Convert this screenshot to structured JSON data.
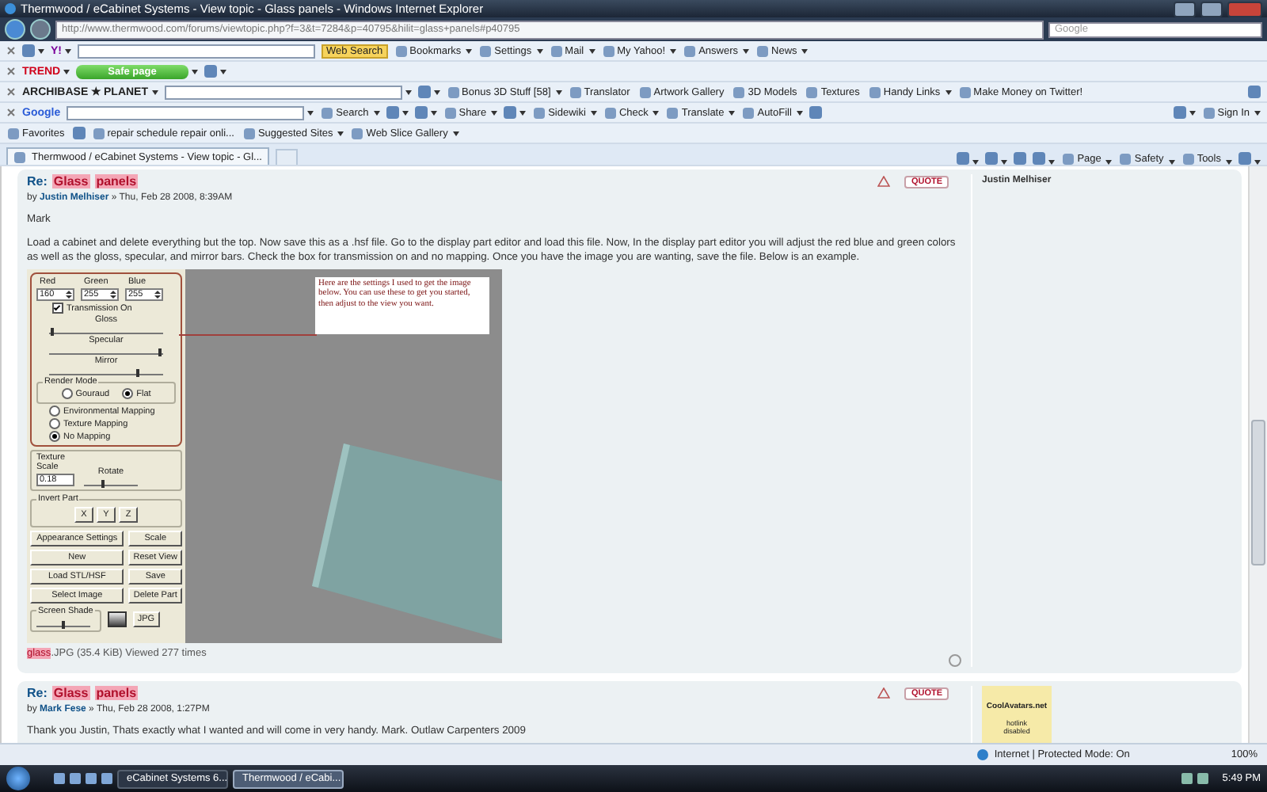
{
  "window": {
    "title": "Thermwood / eCabinet Systems - View topic - Glass panels - Windows Internet Explorer"
  },
  "address_bar": {
    "url": "http://www.thermwood.com/forums/viewtopic.php?f=3&t=7284&p=40795&hilit=glass+panels#p40795",
    "search_placeholder": "Google"
  },
  "toolbars": [
    {
      "left": [
        {
          "kind": "close"
        },
        {
          "kind": "icon",
          "dropdown": true
        },
        {
          "kind": "logo",
          "label": "Y!",
          "color": "#7b0099",
          "dropdown": true
        },
        {
          "kind": "field"
        },
        {
          "kind": "highlight",
          "label": "Web Search"
        },
        {
          "kind": "button",
          "label": "Bookmarks",
          "dropdown": true
        },
        {
          "kind": "button",
          "label": "Settings",
          "dropdown": true
        },
        {
          "kind": "button",
          "label": "Mail",
          "dropdown": true
        },
        {
          "kind": "button",
          "label": "My Yahoo!",
          "dropdown": true
        },
        {
          "kind": "button",
          "label": "Answers",
          "dropdown": true
        },
        {
          "kind": "button",
          "label": "News",
          "dropdown": true
        }
      ]
    },
    {
      "left": [
        {
          "kind": "close"
        },
        {
          "kind": "logo",
          "label": "TREND",
          "color": "#d0021b",
          "dropdown": true
        },
        {
          "kind": "pill",
          "label": "Safe page",
          "dropdown": true
        },
        {
          "kind": "icon",
          "dropdown": true
        }
      ]
    },
    {
      "left": [
        {
          "kind": "close"
        },
        {
          "kind": "logo",
          "label": "ARCHIBASE ★ PLANET",
          "color": "#222222",
          "dropdown": true
        },
        {
          "kind": "field",
          "dropdown": true
        },
        {
          "kind": "icon",
          "dropdown": true
        },
        {
          "kind": "button",
          "label": "Bonus 3D Stuff  [58]",
          "dropdown": true
        },
        {
          "kind": "button",
          "label": "Translator"
        },
        {
          "kind": "button",
          "label": "Artwork Gallery"
        },
        {
          "kind": "button",
          "label": "3D Models"
        },
        {
          "kind": "button",
          "label": "Textures"
        },
        {
          "kind": "button",
          "label": "Handy Links",
          "dropdown": true
        },
        {
          "kind": "button",
          "label": "Make Money on Twitter!"
        }
      ],
      "right": [
        {
          "kind": "icon"
        }
      ]
    },
    {
      "left": [
        {
          "kind": "close"
        },
        {
          "kind": "logo",
          "label": "Google",
          "color": "#2a5bd7"
        },
        {
          "kind": "field",
          "dropdown": true
        },
        {
          "kind": "button",
          "label": "Search",
          "dropdown": true
        },
        {
          "kind": "icon",
          "dropdown": true
        },
        {
          "kind": "icon",
          "dropdown": true
        },
        {
          "kind": "button",
          "label": "Share",
          "dropdown": true
        },
        {
          "kind": "icon",
          "dropdown": true
        },
        {
          "kind": "button",
          "label": "Sidewiki",
          "dropdown": true
        },
        {
          "kind": "button",
          "label": "Check",
          "dropdown": true
        },
        {
          "kind": "button",
          "label": "Translate",
          "dropdown": true
        },
        {
          "kind": "button",
          "label": "AutoFill",
          "dropdown": true
        },
        {
          "kind": "icon"
        }
      ],
      "right": [
        {
          "kind": "icon",
          "dropdown": true
        },
        {
          "kind": "button",
          "label": "Sign In",
          "dropdown": true
        }
      ]
    },
    {
      "left": [
        {
          "kind": "button",
          "label": "Favorites"
        },
        {
          "kind": "icon"
        },
        {
          "kind": "button",
          "label": "repair schedule repair onli..."
        },
        {
          "kind": "button",
          "label": "Suggested Sites",
          "dropdown": true
        },
        {
          "kind": "button",
          "label": "Web Slice Gallery",
          "dropdown": true
        }
      ]
    },
    {
      "left": [
        {
          "kind": "tab",
          "label": "Thermwood / eCabinet Systems - View topic - Gl..."
        },
        {
          "kind": "newtab"
        }
      ],
      "right": [
        {
          "kind": "icon",
          "dropdown": true
        },
        {
          "kind": "icon",
          "dropdown": true
        },
        {
          "kind": "icon"
        },
        {
          "kind": "icon",
          "dropdown": true
        },
        {
          "kind": "button",
          "label": "Page",
          "dropdown": true
        },
        {
          "kind": "button",
          "label": "Safety",
          "dropdown": true
        },
        {
          "kind": "button",
          "label": "Tools",
          "dropdown": true
        },
        {
          "kind": "icon",
          "dropdown": true
        }
      ]
    }
  ],
  "posts": [
    {
      "title_prefix": "Re:",
      "title_words": [
        "Glass",
        "panels"
      ],
      "byline": "by **Justin Melhiser** » Thu, Feb 28 2008, 8:39AM",
      "quote_label": "QUOTE",
      "author": "Justin Melhiser",
      "body": [
        "Mark",
        "Load a cabinet and delete everything but the top. Now save this as a .hsf file. Go to the display part editor and load this file. Now, In the display part editor you will adjust the red blue and green colors as well as the gloss, specular, and mirror bars. Check the box for transmission on and no mapping. Once you have the image you are wanting, save the file. Below is an example."
      ],
      "attachment": {
        "editor": {
          "channels": [
            {
              "label": "Red",
              "value": "160"
            },
            {
              "label": "Green",
              "value": "255"
            },
            {
              "label": "Blue",
              "value": "255"
            }
          ],
          "transmission": {
            "label": "Transmission On",
            "checked": true
          },
          "sliders": [
            {
              "label": "Gloss",
              "level": 0.03
            },
            {
              "label": "Specular",
              "level": 0.97
            },
            {
              "label": "Mirror",
              "level": 0.78
            }
          ],
          "render_mode": {
            "title": "Render Mode",
            "options": [
              {
                "label": "Gouraud",
                "selected": false
              },
              {
                "label": "Flat",
                "selected": true
              }
            ]
          },
          "mapping": [
            {
              "label": "Environmental Mapping",
              "selected": false
            },
            {
              "label": "Texture Mapping",
              "selected": false
            },
            {
              "label": "No Mapping",
              "selected": true
            }
          ],
          "texture": {
            "title": "Texture Scale",
            "value": "0.18",
            "rotate": {
              "label": "Rotate",
              "level": 0.35
            }
          },
          "invert": {
            "title": "Invert Part",
            "buttons": [
              "X",
              "Y",
              "Z"
            ]
          },
          "buttons": [
            "Appearance Settings",
            "Scale",
            "New",
            "Reset View",
            "Load STL/HSF",
            "Save",
            "Select Image",
            "Delete Part"
          ],
          "screen_shade": {
            "title": "Screen Shade",
            "level": 0.5,
            "button": "JPG"
          }
        },
        "note": "Here are the settings I used to get the image below.  You can use these to get you started, then adjust to the view you want.",
        "caption_highlight": "glass",
        "caption_rest": ".JPG (35.4 KiB) Viewed 277 times"
      }
    },
    {
      "title_prefix": "Re:",
      "title_words": [
        "Glass",
        "panels"
      ],
      "byline": "by **Mark Fese** » Thu, Feb 28 2008, 1:27PM",
      "quote_label": "QUOTE",
      "avatar": {
        "title": "CoolAvatars.net",
        "text": "hotlink disabled"
      },
      "body": [
        "Thank you Justin, Thats exactly what I wanted and will come in very handy. Mark. Outlaw Carpenters 2009"
      ]
    }
  ],
  "status_bar": {
    "zone": "Internet | Protected Mode: On",
    "zoom": "100%"
  },
  "taskbar": {
    "tasks": [
      {
        "label": "eCabinet Systems 6...",
        "selected": false
      },
      {
        "label": "Thermwood / eCabi...",
        "selected": true
      }
    ],
    "time": "5:49 PM"
  }
}
